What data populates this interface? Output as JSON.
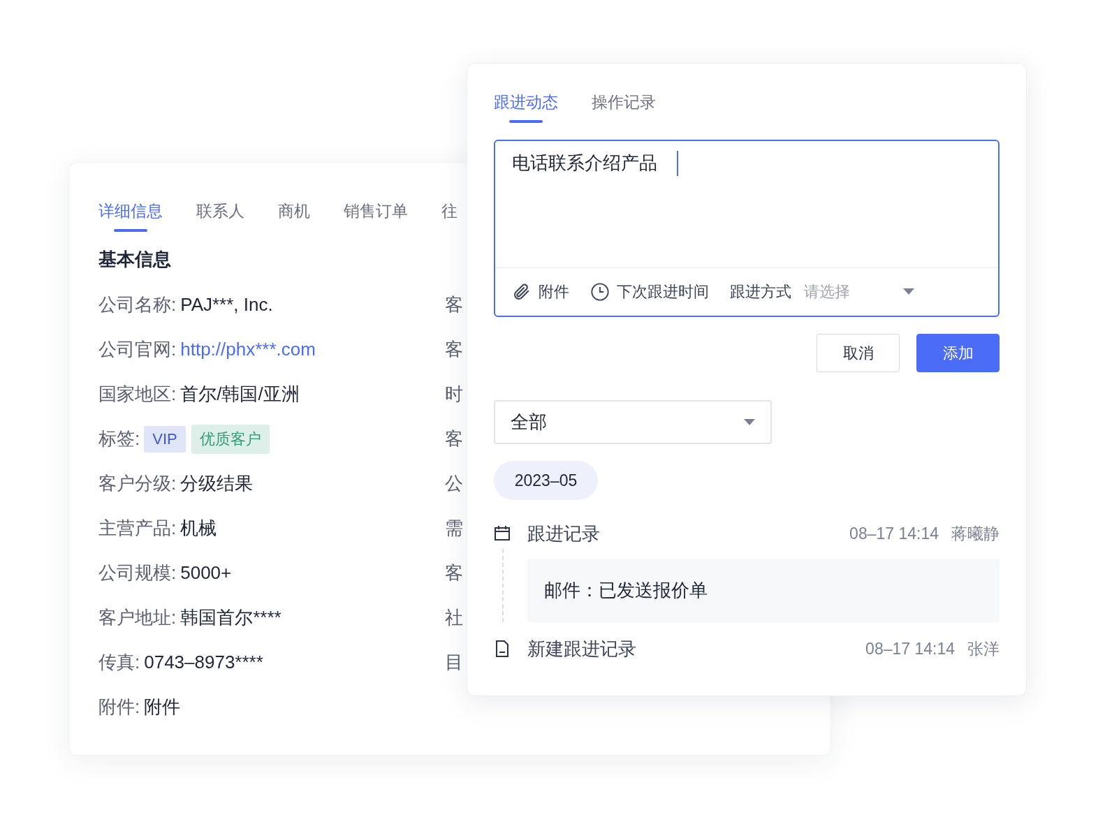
{
  "detail_card": {
    "tabs": [
      {
        "label": "详细信息",
        "selected": true
      },
      {
        "label": "联系人",
        "selected": false
      },
      {
        "label": "商机",
        "selected": false
      },
      {
        "label": "销售订单",
        "selected": false
      },
      {
        "label": "往",
        "selected": false
      }
    ],
    "section_title": "基本信息",
    "fields": [
      {
        "kind": "text",
        "label": "公司名称:",
        "value": "PAJ***, Inc."
      },
      {
        "kind": "link",
        "label": "公司官网:",
        "value": "http://phx***.com"
      },
      {
        "kind": "text",
        "label": "国家地区:",
        "value": "首尔/韩国/亚洲"
      },
      {
        "kind": "tags",
        "label": "标签:",
        "tags": [
          {
            "label": "VIP",
            "color": "#3d5bd9"
          },
          {
            "label": "优质客户",
            "color": "#2e9c77"
          }
        ]
      },
      {
        "kind": "text",
        "label": "客户分级:",
        "value": "分级结果"
      },
      {
        "kind": "text",
        "label": "主营产品:",
        "value": "机械"
      },
      {
        "kind": "text",
        "label": "公司规模:",
        "value": "5000+"
      },
      {
        "kind": "text",
        "label": "客户地址:",
        "value": "韩国首尔****"
      },
      {
        "kind": "text",
        "label": "传真:",
        "value": "0743–8973****"
      },
      {
        "kind": "text",
        "label": "附件:",
        "value": "附件"
      }
    ],
    "right_column": [
      "客",
      "客",
      "时",
      "客",
      "公",
      "需",
      "客",
      "社",
      "目"
    ]
  },
  "follow_card": {
    "tabs": [
      {
        "label": "跟进动态",
        "selected": true
      },
      {
        "label": "操作记录",
        "selected": false
      }
    ],
    "editor": {
      "value": "电话联系介绍产品",
      "attachment": "附件",
      "next_time": "下次跟进时间",
      "method_label": "跟进方式",
      "method_placeholder": "请选择"
    },
    "buttons": {
      "cancel": "取消",
      "add": "添加"
    },
    "filter": {
      "value": "全部"
    },
    "month": "2023–05",
    "records": [
      {
        "kind": "calendar",
        "title": "跟进记录",
        "time": "08–17 14:14",
        "user": "蒋曦静",
        "content": "邮件：已发送报价单"
      },
      {
        "kind": "document",
        "title": "新建跟进记录",
        "time": "08–17 14:14",
        "user": "张洋"
      }
    ]
  }
}
